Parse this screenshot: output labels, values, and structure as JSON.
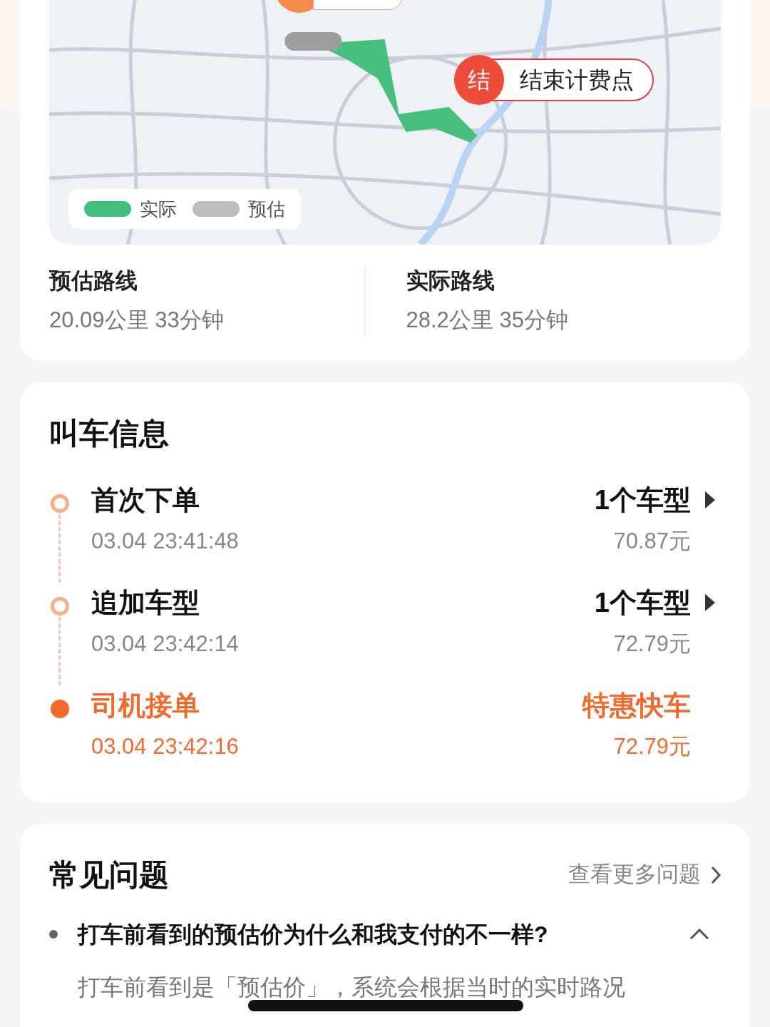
{
  "map": {
    "end_pin": {
      "badge": "结",
      "label": "结束计费点"
    },
    "legend": [
      {
        "label": "实际",
        "color": "#3fbf7a"
      },
      {
        "label": "预估",
        "color": "#bdbdbd"
      }
    ]
  },
  "routes": [
    {
      "title": "预估路线",
      "detail": "20.09公里 33分钟"
    },
    {
      "title": "实际路线",
      "detail": "28.2公里 35分钟"
    }
  ],
  "call_info": {
    "title": "叫车信息",
    "events": [
      {
        "name": "首次下单",
        "time": "03.04 23:41:48",
        "car": "1个车型",
        "price": "70.87元",
        "current": false
      },
      {
        "name": "追加车型",
        "time": "03.04 23:42:14",
        "car": "1个车型",
        "price": "72.79元",
        "current": false
      },
      {
        "name": "司机接单",
        "time": "03.04 23:42:16",
        "car": "特惠快车",
        "price": "72.79元",
        "current": true
      }
    ]
  },
  "faq": {
    "title": "常见问题",
    "more": "查看更多问题",
    "items": [
      {
        "question": "打车前看到的预估价为什么和我支付的不一样?",
        "expanded": true,
        "answer": "打车前看到是「预估价」，系统会根据当时的实时路况"
      }
    ]
  }
}
